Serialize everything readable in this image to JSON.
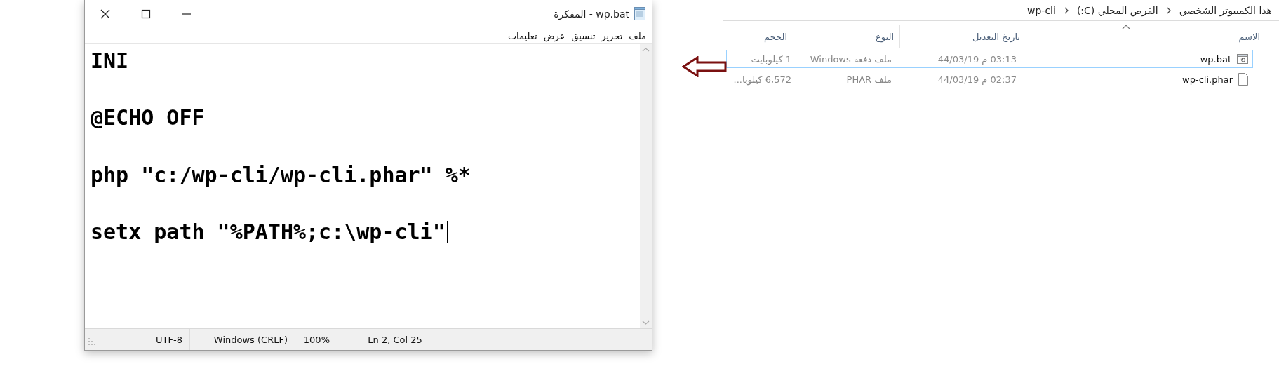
{
  "notepad": {
    "title": "wp.bat - المفكرة",
    "menu": [
      "ملف",
      "تحرير",
      "تنسيق",
      "عرض",
      "تعليمات"
    ],
    "lines": [
      "INI",
      "@ECHO OFF",
      "php \"c:/wp-cli/wp-cli.phar\" %*",
      "setx path \"%PATH%;c:\\wp-cli\""
    ],
    "status": [
      "Ln 2, Col 25",
      "100%",
      "Windows (CRLF)",
      "UTF-8"
    ]
  },
  "explorer": {
    "breadcrumb": [
      "هذا الكمبيوتر الشخصي",
      "القرص المحلي (C:)",
      "wp-cli"
    ],
    "columns": [
      {
        "label": "الاسم",
        "sorted": true
      },
      {
        "label": "تاريخ التعديل",
        "sorted": false
      },
      {
        "label": "النوع",
        "sorted": false
      },
      {
        "label": "الحجم",
        "sorted": false
      }
    ],
    "rows": [
      {
        "kind": "batch",
        "name": "wp.bat",
        "date": "03:13 م 44/03/19",
        "type": "ملف دفعة Windows",
        "size": "1 كيلوبايت",
        "selected": true
      },
      {
        "kind": "file",
        "name": "wp-cli.phar",
        "date": "02:37 م 44/03/19",
        "type": "ملف PHAR",
        "size": "6,572 كيلوبا...",
        "selected": false
      }
    ]
  }
}
